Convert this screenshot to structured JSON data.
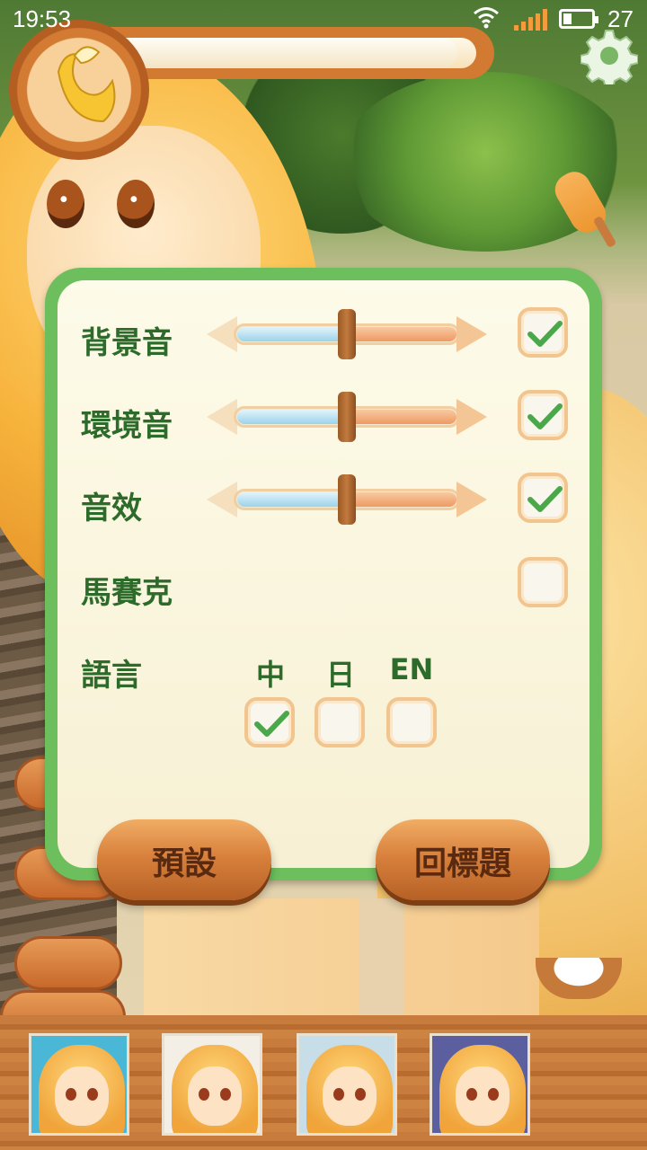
{
  "status_bar": {
    "time": "19:53",
    "battery_level": "27",
    "wifi_icon": "wifi-icon",
    "signal_icon": "cell-signal-icon",
    "battery_icon": "battery-icon"
  },
  "hud": {
    "emblem_icon": "banana-icon",
    "settings_icon": "gear-icon",
    "progress_fraction": 0.95
  },
  "settings": {
    "rows": [
      {
        "key": "bgm",
        "label": "背景音",
        "volume": 0.5,
        "enabled": true
      },
      {
        "key": "ambient",
        "label": "環境音",
        "volume": 0.5,
        "enabled": true
      },
      {
        "key": "sfx",
        "label": "音效",
        "volume": 0.5,
        "enabled": true
      },
      {
        "key": "mosaic",
        "label": "馬賽克",
        "enabled": false
      }
    ],
    "language": {
      "label": "語言",
      "options": [
        {
          "label": "中",
          "selected": true
        },
        {
          "label": "日",
          "selected": false
        },
        {
          "label": "EN",
          "selected": false
        }
      ]
    },
    "buttons": {
      "default_label": "預設",
      "title_label": "回標題"
    }
  },
  "characters": [
    {
      "name": "character-1",
      "bg": "#4bb7d6"
    },
    {
      "name": "character-2",
      "bg": "#f4efe6"
    },
    {
      "name": "character-3",
      "bg": "#c7dde8"
    },
    {
      "name": "character-4",
      "bg": "#5b5fa0"
    }
  ],
  "colors": {
    "panel_border": "#6dbf5d",
    "label_green": "#2c6b2a",
    "wood": "#d8813d",
    "check_green": "#4aa84a"
  }
}
